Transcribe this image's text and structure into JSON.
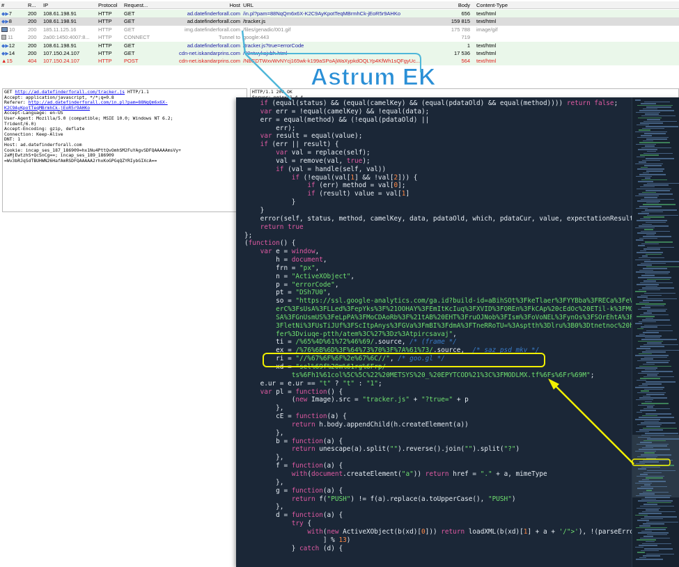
{
  "title": "Astrum EK",
  "sessions": {
    "columns": [
      "#",
      "R...",
      "IP",
      "Protocol",
      "Request...",
      "Host",
      "URL",
      "Body",
      "Content-Type"
    ],
    "rows": [
      {
        "num": "7",
        "result": "200",
        "ip": "108.61.198.91",
        "protocol": "HTTP",
        "method": "GET",
        "host": "ad.datefinderforall.com",
        "url": "/in.pl?pam=88NqQm6x6X-K2C9AyKpotTeqMBrmhCk-jEoR5r9AHKo",
        "body": "656",
        "ctype": "text/html",
        "icon": "arrows-icon",
        "style": "green"
      },
      {
        "num": "8",
        "result": "200",
        "ip": "108.61.198.91",
        "protocol": "HTTP",
        "method": "GET",
        "host": "ad.datefinderforall.com",
        "url": "/tracker.js",
        "body": "159 815",
        "ctype": "text/html",
        "icon": "arrows-icon",
        "style": "selected"
      },
      {
        "num": "10",
        "result": "200",
        "ip": "185.11.125.16",
        "protocol": "HTTP",
        "method": "GET",
        "host": "img.datefinderforall.com",
        "url": "/files/genadic/001.gif",
        "body": "175 788",
        "ctype": "image/gif",
        "icon": "image-icon",
        "style": "plain"
      },
      {
        "num": "11",
        "result": "200",
        "ip": "2a00:1450:4007:8...",
        "protocol": "HTTP",
        "method": "CONNECT",
        "host": "Tunnel to",
        "url": "google:443",
        "body": "719",
        "ctype": "",
        "icon": "lock-icon",
        "style": "plain"
      },
      {
        "num": "12",
        "result": "200",
        "ip": "108.61.198.91",
        "protocol": "HTTP",
        "method": "GET",
        "host": "ad.datefinderforall.com",
        "url": "/tracker.js?true=errorCode",
        "body": "1",
        "ctype": "text/html",
        "icon": "arrows-icon",
        "style": "green"
      },
      {
        "num": "14",
        "result": "200",
        "ip": "107.150.24.107",
        "protocol": "HTTP",
        "method": "GET",
        "host": "cdn-net.iskandarprins.com",
        "url": "/90ntwyksjxbh.html",
        "body": "17 536",
        "ctype": "text/html",
        "icon": "arrows-icon",
        "style": "green"
      },
      {
        "num": "15",
        "result": "404",
        "ip": "107.150.24.107",
        "protocol": "HTTP",
        "method": "POST",
        "host": "cdn-net.iskandarprins.com",
        "url": "/NBEDTWxvWvNYcj165wk-k199aSPoAjWaXypkdOQLYp4KfWh1sQFgyUc...",
        "body": "564",
        "ctype": "text/html",
        "icon": "warning-icon",
        "style": "green"
      }
    ]
  },
  "request": {
    "lines": [
      "Accept: application/javascript, */*;q=0.8",
      "Accept-Language: en-US",
      "User-Agent: Mozilla/5.0 (compatible; MSIE 10.0; Windows NT 6.2;",
      "Trident/6.0)",
      "Accept-Encoding: gzip, deflate",
      "Connection: Keep-Alive",
      "DNT: 1",
      "Host: ad.datefinderforall.com",
      "Cookie: incap_ses_187_186909=hx1Nu4PttQvOmhSM2FuYAgvSDFQAAAAAmsVy+",
      "2aMjEwtzhS+QcSnCg==; incap_ses_189_186909",
      "=Wv3bRJqSdTBUHWN26HafAmRSDFQAAAAA2rhxKoGPGqQZYRIybGIXcA=="
    ],
    "get_method": "GET",
    "get_url": "http://ad.datefinderforall.com/tracker.js",
    "get_proto": "HTTP/1.1",
    "referer_label": "Referer:",
    "referer_url": "http://ad.datefinderforall.com/in.pl?pam=88NqQm6x6X-",
    "referer_url2": "K2C9AyKpotTeqMBrmhCk-jEoR5r9AHKo"
  },
  "response": {
    "lines": [
      "HTTP/1.1 200 OK",
      "Server: nginx/1.4.4"
    ]
  },
  "colors": {
    "title": "#2a8fd6",
    "editor_bg": "#1b2737",
    "keyword": "#e05aa3",
    "string": "#6fe06f",
    "comment": "#3a7cc7",
    "number": "#ff8a47",
    "highlight": "#f2f000",
    "callout": "#4fb7d9"
  }
}
